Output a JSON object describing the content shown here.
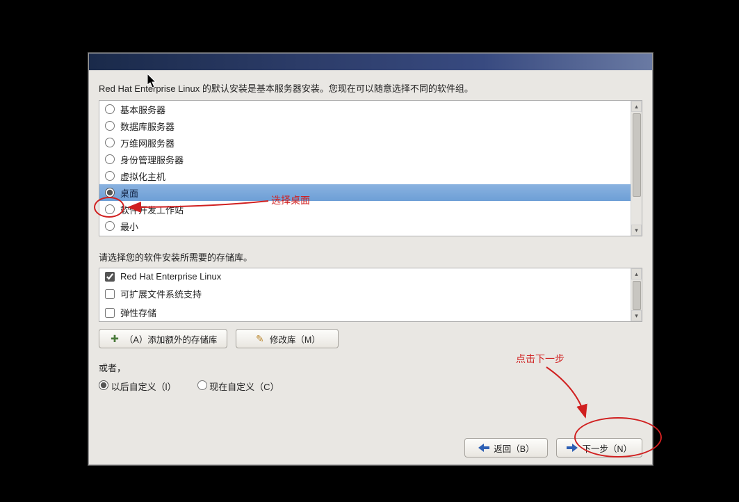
{
  "heading": "Red Hat Enterprise Linux 的默认安装是基本服务器安装。您现在可以随意选择不同的软件组。",
  "software_groups": [
    {
      "label": "基本服务器",
      "selected": false
    },
    {
      "label": "数据库服务器",
      "selected": false
    },
    {
      "label": "万维网服务器",
      "selected": false
    },
    {
      "label": "身份管理服务器",
      "selected": false
    },
    {
      "label": "虚拟化主机",
      "selected": false
    },
    {
      "label": "桌面",
      "selected": true
    },
    {
      "label": "软件开发工作站",
      "selected": false
    },
    {
      "label": "最小",
      "selected": false
    }
  ],
  "repo_heading": "请选择您的软件安装所需要的存储库。",
  "repos": [
    {
      "label": "Red Hat Enterprise Linux",
      "checked": true
    },
    {
      "label": "可扩展文件系统支持",
      "checked": false
    },
    {
      "label": "弹性存储",
      "checked": false
    }
  ],
  "buttons": {
    "add_repo": "（A）添加额外的存储库",
    "modify_repo": "修改库（M）",
    "back": "返回（B）",
    "next": "下一步（N）"
  },
  "or_label": "或者，",
  "customize": {
    "later": "以后自定义（l）",
    "now": "现在自定义（C）"
  },
  "annotations": {
    "select_desktop": "选择桌面",
    "click_next": "点击下一步"
  }
}
